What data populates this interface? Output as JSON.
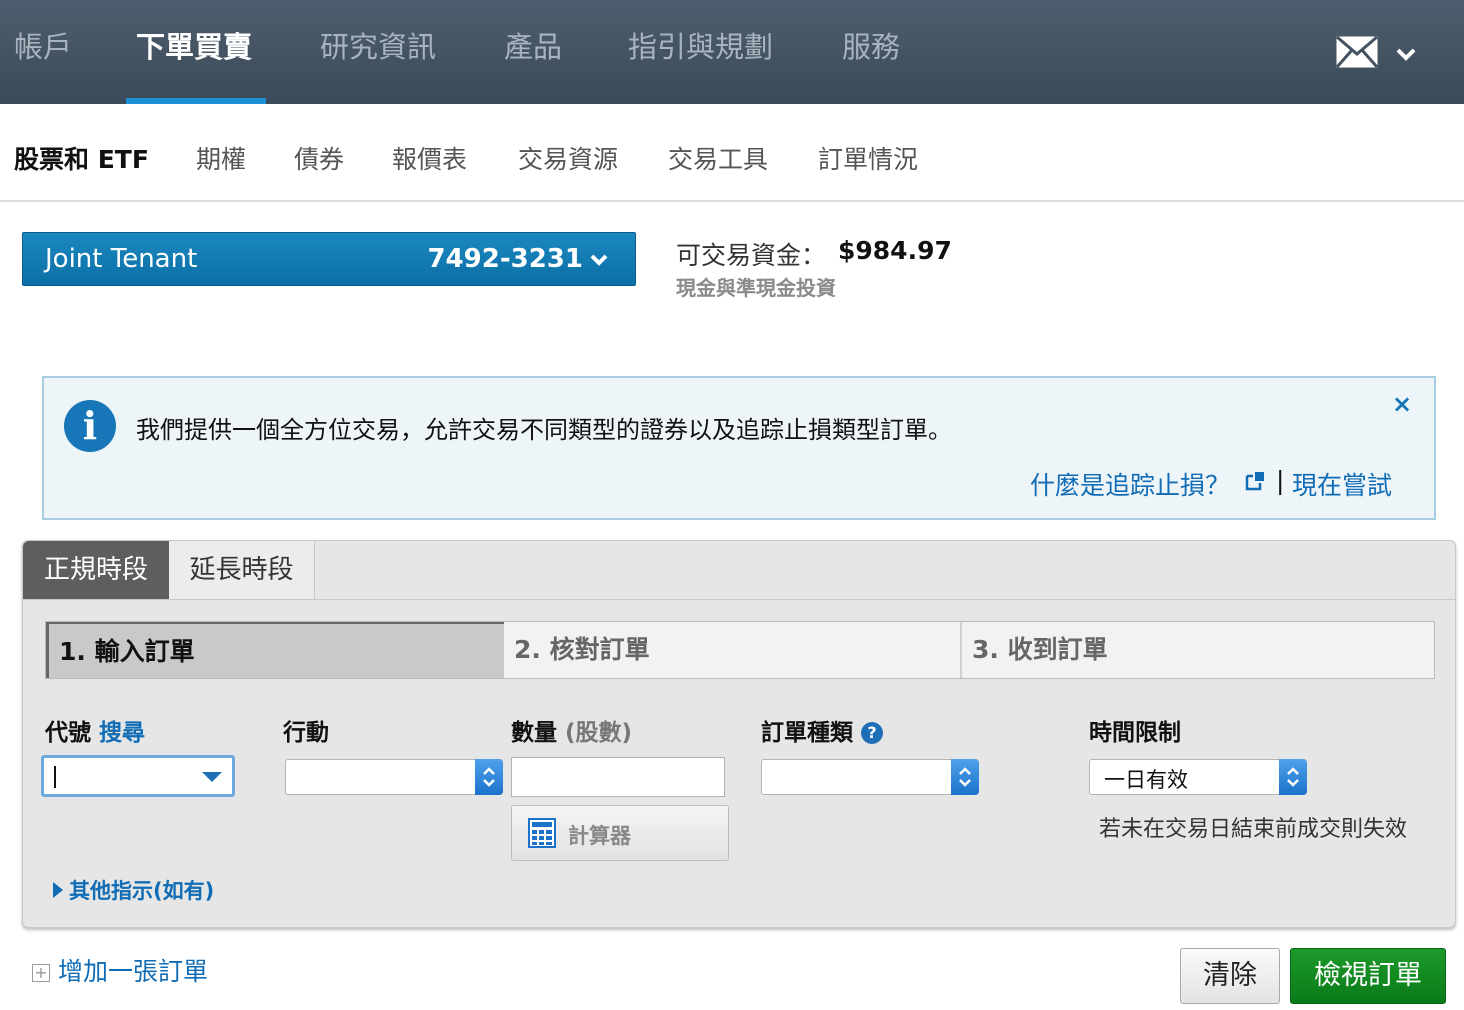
{
  "topnav": {
    "items": [
      "帳戶",
      "下單買賣",
      "研究資訊",
      "產品",
      "指引與規劃",
      "服務"
    ],
    "active_index": 1,
    "mail_icon": "mail-icon",
    "menu_icon": "chevron-down-icon"
  },
  "subnav": {
    "items": [
      "股票和 ETF",
      "期權",
      "債券",
      "報價表",
      "交易資源",
      "交易工具",
      "訂單情況"
    ],
    "active_index": 0
  },
  "account": {
    "name": "Joint Tenant",
    "number": "7492-3231"
  },
  "funds": {
    "label": "可交易資金：",
    "value": "$984.97",
    "sub": "現金與準現金投資"
  },
  "banner": {
    "icon": "info-icon",
    "message": "我們提供一個全方位交易，允許交易不同類型的證券以及追踪止損類型訂單。",
    "link_whatis": "什麼是追踪止損？",
    "separator": "|",
    "link_try": "現在嘗試",
    "close": "×"
  },
  "session_tabs": [
    "正規時段",
    "延長時段"
  ],
  "steps": [
    "1. 輸入訂單",
    "2. 核對訂單",
    "3. 收到訂單"
  ],
  "form": {
    "symbol_label": "代號",
    "symbol_search": "搜尋",
    "symbol_value": "",
    "action_label": "行動",
    "action_value": "",
    "quantity_label": "數量",
    "quantity_unit": "(股數)",
    "quantity_value": "",
    "calculator_label": "計算器",
    "order_type_label": "訂單種類",
    "order_type_value": "",
    "time_limit_label": "時間限制",
    "time_limit_value": "一日有效",
    "time_limit_note": "若未在交易日結束前成交則失效",
    "other_instructions": "其他指示(如有)"
  },
  "footer": {
    "add_order": "增加一張訂單",
    "clear": "清除",
    "review": "檢視訂單"
  },
  "colors": {
    "nav_bg": "#44525f",
    "accent": "#1f8fd6",
    "account_bg": "#1380b8",
    "link": "#0f6cb5",
    "review_button": "#12882a"
  }
}
